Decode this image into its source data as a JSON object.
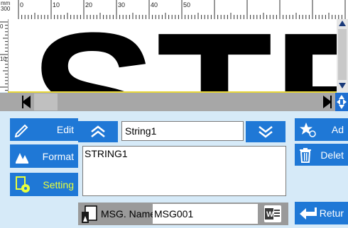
{
  "ruler": {
    "unit": "mm",
    "scale": "300",
    "top_labels": [
      "0",
      "10",
      "20",
      "30",
      "40",
      "50"
    ],
    "left_labels": [
      "0",
      "10"
    ]
  },
  "canvas": {
    "visible_text": "STE"
  },
  "left_buttons": [
    {
      "label": "Edit",
      "icon": "pencil-icon"
    },
    {
      "label": "Format",
      "icon": "format-icon"
    },
    {
      "label": "Setting",
      "icon": "setting-icon",
      "color": "#e8ff3a"
    }
  ],
  "right_buttons": [
    {
      "label": "Ad",
      "icon": "star-add-icon"
    },
    {
      "label": "Delet",
      "icon": "trash-icon"
    },
    {
      "label": "Retur",
      "icon": "return-arrow-icon"
    }
  ],
  "editor": {
    "string_field": "String1",
    "content": "STRING1"
  },
  "message": {
    "label": "MSG. Name",
    "value": "MSG001"
  },
  "colors": {
    "button_blue": "#1f78d6",
    "panel_bg": "#d6eaf8",
    "setting_label": "#e8ff3a"
  }
}
